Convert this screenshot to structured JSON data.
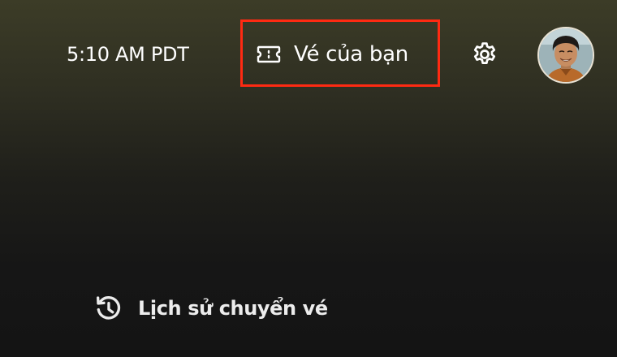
{
  "header": {
    "time": "5:10 AM PDT",
    "tickets_label": "Vé của bạn",
    "tickets_icon": "ticket-icon",
    "settings_icon": "gear-icon",
    "avatar_icon": "user-avatar",
    "highlight_color": "#ff2a12"
  },
  "footer": {
    "history_label": "Lịch sử chuyển vé",
    "history_icon": "history-icon"
  }
}
